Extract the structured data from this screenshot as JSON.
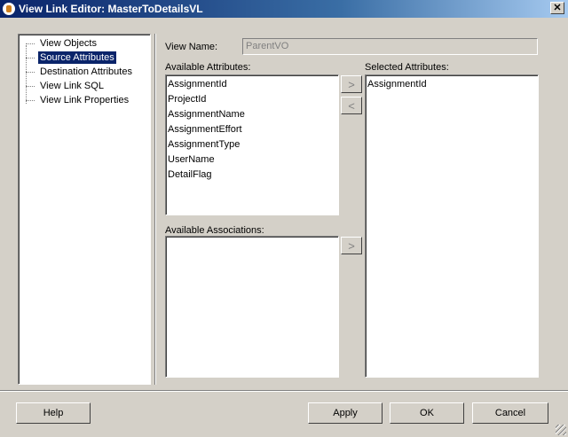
{
  "window": {
    "title": "View Link Editor: MasterToDetailsVL",
    "close_glyph": "✕"
  },
  "tree": {
    "items": [
      {
        "label": "View Objects"
      },
      {
        "label": "Source Attributes"
      },
      {
        "label": "Destination Attributes"
      },
      {
        "label": "View Link SQL"
      },
      {
        "label": "View Link Properties"
      }
    ],
    "selected": "Source Attributes"
  },
  "view_name": {
    "label": "View Name:",
    "value": "ParentVO"
  },
  "available_attributes": {
    "label": "Available Attributes:",
    "items": [
      "AssignmentId",
      "ProjectId",
      "AssignmentName",
      "AssignmentEffort",
      "AssignmentType",
      "UserName",
      "DetailFlag"
    ]
  },
  "selected_attributes": {
    "label": "Selected Attributes:",
    "items": [
      "AssignmentId"
    ]
  },
  "available_associations": {
    "label": "Available Associations:",
    "items": []
  },
  "buttons": {
    "move_right": ">",
    "move_left": "<",
    "assoc_move": ">",
    "help": "Help",
    "apply": "Apply",
    "ok": "OK",
    "cancel": "Cancel"
  }
}
